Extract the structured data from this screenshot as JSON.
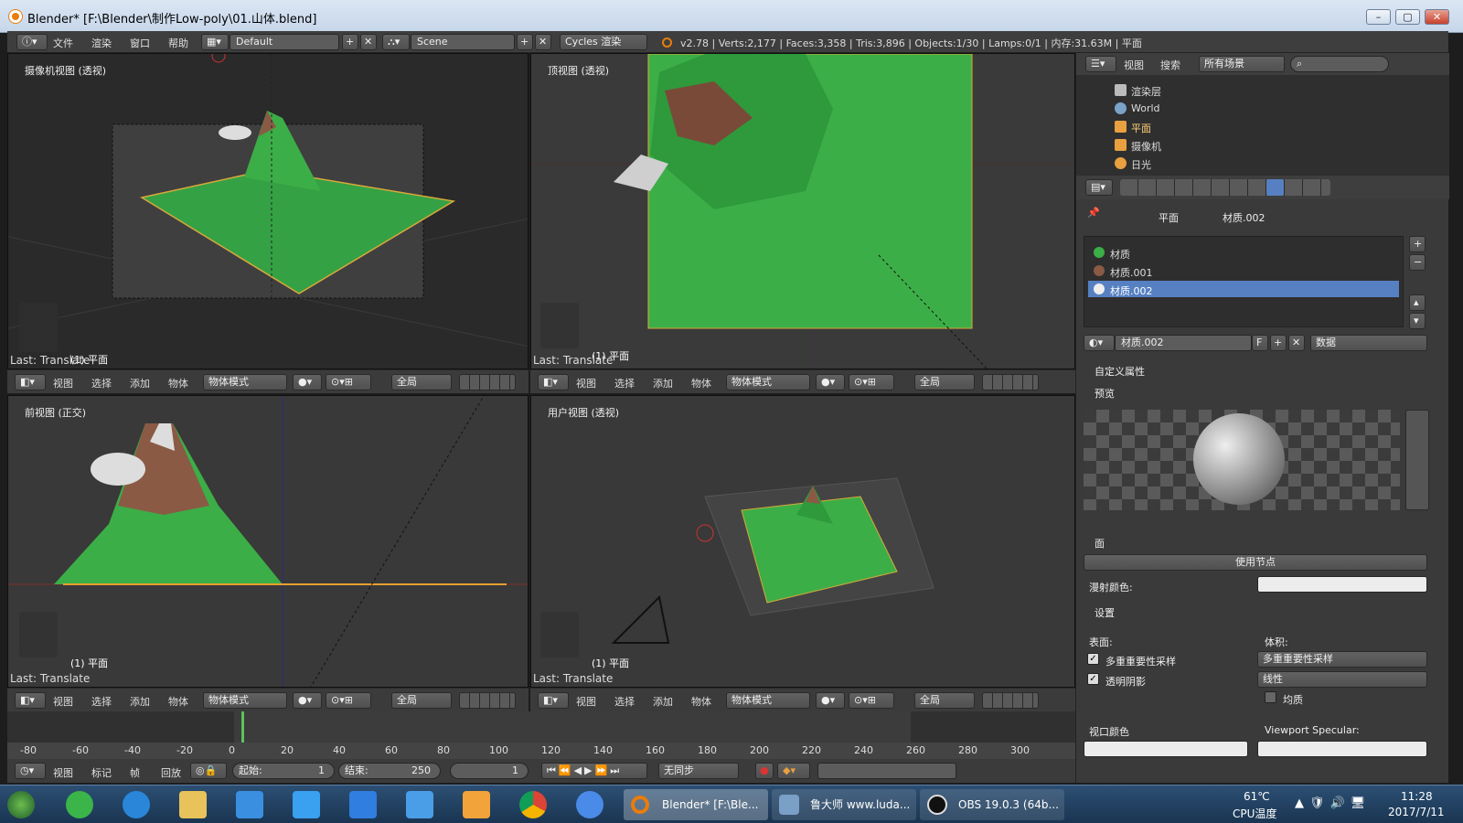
{
  "window": {
    "title": "Blender* [F:\\Blender\\制作Low-poly\\01.山体.blend]"
  },
  "infobar": {
    "menus": [
      "文件",
      "渲染",
      "窗口",
      "帮助"
    ],
    "layout": "Default",
    "scene": "Scene",
    "engine": "Cycles 渲染",
    "stats": "v2.78 | Verts:2,177 | Faces:3,358 | Tris:3,896 | Objects:1/30 | Lamps:0/1 | 内存:31.63M | 平面"
  },
  "viewports": [
    {
      "label": "摄像机视图 (透视)",
      "obj": "(1) 平面",
      "last": "Last: Translate"
    },
    {
      "label": "顶视图 (透视)",
      "obj": "(1) 平面",
      "last": "Last: Translate"
    },
    {
      "label": "前视图 (正交)",
      "obj": "(1) 平面",
      "last": "Last: Translate"
    },
    {
      "label": "用户视图 (透视)",
      "obj": "(1) 平面",
      "last": "Last: Translate"
    }
  ],
  "vpheader": {
    "menus": [
      "视图",
      "选择",
      "添加",
      "物体"
    ],
    "mode": "物体模式",
    "pivot": "全局"
  },
  "outliner": {
    "menus": [
      "视图",
      "搜索"
    ],
    "filter": "所有场景",
    "items": [
      "渲染层",
      "World",
      "平面",
      "摄像机",
      "日光"
    ]
  },
  "props": {
    "breadcrumb": [
      "平面",
      "材质.002"
    ],
    "materials": [
      "材质",
      "材质.001",
      "材质.002"
    ],
    "material_name": "材质.002",
    "slot_flag": "F",
    "link": "数据",
    "sections": {
      "custom": "自定义属性",
      "preview": "预览",
      "surface": "面",
      "settings": "设置",
      "viewport_color": "视口颜色",
      "viewport_spec": "Viewport Specular:"
    },
    "use_nodes": "使用节点",
    "diffuse": "漫射颜色:",
    "surface_lbl": "表面:",
    "volume_lbl": "体积:",
    "cb1": "多重重要性采样",
    "cb2": "透明阴影",
    "vol_sampling": "多重重要性采样",
    "vol_interp": "线性",
    "homog": "均质"
  },
  "timeline": {
    "menus": [
      "视图",
      "标记",
      "帧",
      "回放"
    ],
    "ticks": [
      "-80",
      "-60",
      "-40",
      "-20",
      "0",
      "20",
      "40",
      "60",
      "80",
      "100",
      "120",
      "140",
      "160",
      "180",
      "200",
      "220",
      "240",
      "260",
      "280",
      "300"
    ],
    "start": "起始:",
    "start_val": "1",
    "end": "结束:",
    "end_val": "250",
    "current": "1",
    "sync": "无同步"
  },
  "taskbar": {
    "apps": [
      "Blender* [F:\\Ble...",
      "鲁大师 www.luda...",
      "OBS 19.0.3 (64b..."
    ],
    "temp": "61℃",
    "temp_lbl": "CPU温度",
    "time": "11:28",
    "date": "2017/7/11"
  },
  "colors": {
    "accent": "#5680c2",
    "ground": "#3cae47",
    "mountain": "#8a5a45"
  }
}
